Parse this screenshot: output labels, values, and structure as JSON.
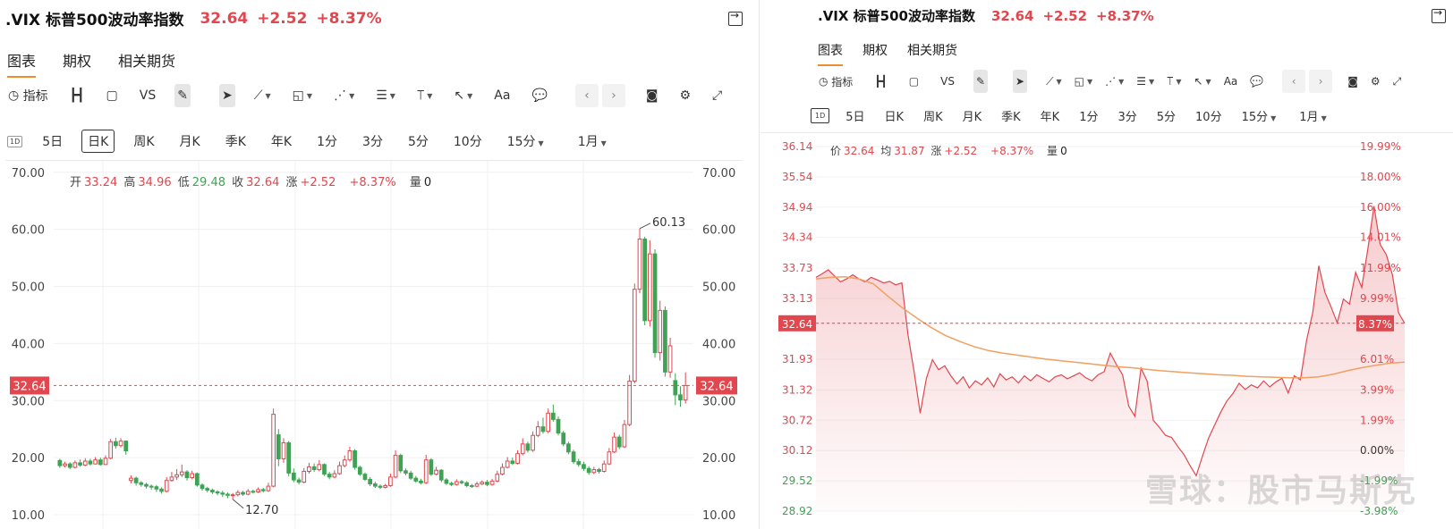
{
  "title": {
    "name": ".VIX 标普500波动率指数",
    "price": "32.64",
    "change": "+2.52",
    "pct": "+8.37%"
  },
  "tabs": [
    "图表",
    "期权",
    "相关期货"
  ],
  "toolbar": {
    "indicators": "指标",
    "vs": "VS",
    "text": "Aa"
  },
  "periods": {
    "chip": "1D",
    "items": [
      "5日",
      "日K",
      "周K",
      "月K",
      "季K",
      "年K",
      "1分",
      "3分",
      "5分",
      "10分",
      "15分"
    ],
    "range": "1月"
  },
  "left_stats": {
    "open_l": "开",
    "open": "33.24",
    "high_l": "高",
    "high": "34.96",
    "low_l": "低",
    "low": "29.48",
    "close_l": "收",
    "close": "32.64",
    "chg_l": "涨",
    "chg": "+2.52",
    "pct": "+8.37%",
    "vol_l": "量",
    "vol": "0"
  },
  "right_stats": {
    "price_l": "价",
    "price": "32.64",
    "avg_l": "均",
    "avg": "31.87",
    "chg_l": "涨",
    "chg": "+2.52",
    "pct": "+8.37%",
    "vol_l": "量",
    "vol": "0"
  },
  "watermark": "雪球：股市马斯克",
  "colors": {
    "up": "#e0474f",
    "down": "#3fa255",
    "avg": "#f0a060",
    "accent": "#f08c2b"
  },
  "chart_data": [
    {
      "type": "candlestick",
      "yticks": [
        "70.00",
        "60.00",
        "50.00",
        "40.00",
        "30.00",
        "20.00",
        "10.00"
      ],
      "ylim": [
        7.5,
        72
      ],
      "current_label": "32.64",
      "annotations": {
        "max": "60.13",
        "min": "12.70"
      },
      "candles": [
        [
          19.5,
          18.6,
          19.8,
          18.2
        ],
        [
          18.6,
          18.9,
          19.3,
          18.3
        ],
        [
          18.9,
          18.3,
          19.2,
          18.0
        ],
        [
          18.3,
          19.1,
          19.5,
          18.1
        ],
        [
          19.1,
          18.7,
          19.7,
          18.4
        ],
        [
          18.7,
          19.4,
          19.9,
          18.5
        ],
        [
          19.4,
          18.9,
          19.8,
          18.6
        ],
        [
          18.9,
          19.6,
          20.1,
          18.8
        ],
        [
          19.6,
          18.8,
          20.0,
          18.6
        ],
        [
          18.8,
          19.9,
          20.4,
          18.7
        ],
        [
          19.9,
          22.8,
          23.3,
          19.7
        ],
        [
          22.8,
          22.1,
          23.5,
          21.6
        ],
        [
          22.1,
          22.9,
          23.4,
          21.8
        ],
        [
          22.9,
          21.2,
          23.0,
          20.5
        ],
        [
          16.0,
          16.4,
          16.9,
          15.5
        ],
        [
          16.4,
          15.6,
          16.7,
          15.1
        ],
        [
          15.6,
          15.3,
          15.9,
          14.9
        ],
        [
          15.3,
          15.0,
          15.6,
          14.6
        ],
        [
          15.0,
          14.9,
          15.3,
          14.4
        ],
        [
          14.9,
          14.5,
          15.2,
          14.0
        ],
        [
          14.5,
          14.1,
          14.8,
          13.7
        ],
        [
          14.1,
          16.0,
          16.6,
          13.9
        ],
        [
          16.0,
          16.6,
          17.5,
          15.8
        ],
        [
          16.6,
          17.0,
          18.0,
          16.1
        ],
        [
          17.0,
          17.5,
          18.8,
          16.6
        ],
        [
          17.5,
          16.5,
          17.8,
          16.0
        ],
        [
          16.5,
          17.2,
          17.7,
          16.2
        ],
        [
          17.2,
          15.2,
          17.4,
          14.9
        ],
        [
          15.2,
          14.6,
          15.5,
          14.2
        ],
        [
          14.6,
          14.3,
          14.9,
          13.9
        ],
        [
          14.3,
          14.0,
          14.6,
          13.6
        ],
        [
          14.0,
          13.8,
          14.3,
          13.4
        ],
        [
          13.8,
          13.6,
          14.2,
          13.1
        ],
        [
          13.6,
          13.4,
          13.9,
          12.9
        ],
        [
          13.4,
          13.5,
          13.8,
          12.7
        ],
        [
          13.5,
          13.9,
          14.3,
          13.2
        ],
        [
          13.9,
          13.6,
          14.2,
          13.3
        ],
        [
          13.6,
          14.1,
          14.5,
          13.4
        ],
        [
          14.1,
          14.0,
          14.4,
          13.7
        ],
        [
          14.0,
          14.4,
          14.8,
          13.8
        ],
        [
          14.4,
          14.2,
          14.7,
          13.9
        ],
        [
          14.2,
          15.0,
          15.6,
          14.0
        ],
        [
          15.0,
          27.6,
          28.6,
          14.8
        ],
        [
          24.0,
          19.8,
          25.0,
          18.5
        ],
        [
          19.8,
          22.6,
          23.4,
          19.1
        ],
        [
          22.6,
          17.3,
          22.9,
          16.7
        ],
        [
          17.3,
          16.1,
          18.1,
          15.7
        ],
        [
          16.1,
          15.7,
          16.5,
          15.3
        ],
        [
          15.7,
          17.6,
          18.2,
          15.5
        ],
        [
          17.6,
          18.4,
          19.1,
          17.2
        ],
        [
          18.4,
          17.9,
          19.0,
          17.5
        ],
        [
          17.9,
          18.8,
          19.6,
          17.6
        ],
        [
          18.8,
          17.1,
          19.0,
          16.8
        ],
        [
          17.1,
          16.6,
          17.5,
          16.2
        ],
        [
          16.6,
          17.2,
          17.8,
          16.4
        ],
        [
          17.2,
          18.6,
          19.3,
          17.0
        ],
        [
          18.6,
          19.6,
          20.4,
          18.3
        ],
        [
          19.6,
          21.2,
          21.9,
          19.3
        ],
        [
          21.2,
          18.3,
          21.5,
          17.9
        ],
        [
          18.3,
          17.1,
          18.6,
          16.8
        ],
        [
          17.1,
          16.2,
          17.4,
          15.9
        ],
        [
          16.2,
          15.4,
          16.6,
          15.0
        ],
        [
          15.4,
          15.0,
          15.8,
          14.7
        ],
        [
          15.0,
          14.8,
          15.3,
          14.5
        ],
        [
          14.8,
          15.1,
          15.4,
          14.6
        ],
        [
          15.1,
          16.6,
          17.2,
          14.9
        ],
        [
          16.6,
          20.4,
          21.3,
          16.4
        ],
        [
          20.4,
          17.7,
          20.7,
          17.3
        ],
        [
          17.7,
          17.3,
          18.1,
          16.9
        ],
        [
          17.3,
          16.4,
          17.7,
          16.1
        ],
        [
          16.4,
          15.9,
          16.8,
          15.6
        ],
        [
          15.9,
          15.6,
          16.3,
          15.3
        ],
        [
          15.6,
          19.6,
          20.5,
          15.4
        ],
        [
          19.6,
          17.1,
          19.9,
          16.8
        ],
        [
          17.1,
          17.8,
          18.4,
          16.9
        ],
        [
          17.8,
          16.1,
          18.0,
          15.7
        ],
        [
          16.1,
          15.5,
          16.4,
          15.2
        ],
        [
          15.5,
          15.3,
          15.8,
          15.0
        ],
        [
          15.3,
          15.8,
          16.2,
          15.1
        ],
        [
          15.8,
          15.6,
          16.1,
          15.3
        ],
        [
          15.6,
          15.1,
          15.9,
          14.8
        ],
        [
          15.1,
          15.0,
          15.4,
          14.7
        ],
        [
          15.0,
          15.4,
          15.8,
          14.8
        ],
        [
          15.4,
          15.7,
          16.0,
          15.2
        ],
        [
          15.7,
          15.3,
          16.1,
          15.0
        ],
        [
          15.3,
          15.9,
          16.3,
          15.1
        ],
        [
          15.9,
          17.1,
          17.7,
          15.7
        ],
        [
          17.1,
          18.3,
          19.0,
          16.9
        ],
        [
          18.3,
          19.4,
          20.1,
          18.1
        ],
        [
          19.4,
          19.0,
          20.0,
          18.7
        ],
        [
          19.0,
          20.7,
          21.3,
          18.8
        ],
        [
          20.7,
          22.4,
          23.4,
          20.4
        ],
        [
          22.4,
          21.3,
          22.8,
          20.9
        ],
        [
          21.3,
          23.9,
          24.6,
          21.0
        ],
        [
          23.9,
          25.4,
          26.4,
          23.6
        ],
        [
          25.4,
          24.6,
          27.0,
          24.2
        ],
        [
          24.6,
          27.8,
          28.6,
          24.3
        ],
        [
          27.8,
          26.7,
          29.3,
          26.3
        ],
        [
          26.7,
          24.3,
          27.2,
          23.9
        ],
        [
          24.3,
          22.4,
          24.7,
          22.0
        ],
        [
          22.4,
          21.0,
          22.8,
          20.6
        ],
        [
          21.0,
          19.3,
          21.4,
          18.9
        ],
        [
          19.3,
          18.8,
          19.8,
          18.4
        ],
        [
          18.8,
          18.1,
          19.3,
          17.7
        ],
        [
          18.1,
          17.4,
          18.5,
          17.0
        ],
        [
          17.4,
          17.9,
          18.4,
          17.1
        ],
        [
          17.9,
          17.6,
          18.2,
          17.2
        ],
        [
          17.6,
          18.9,
          19.5,
          17.4
        ],
        [
          18.9,
          21.0,
          21.7,
          18.7
        ],
        [
          21.0,
          23.6,
          24.4,
          20.8
        ],
        [
          23.6,
          21.9,
          24.0,
          21.5
        ],
        [
          21.9,
          25.8,
          26.6,
          21.7
        ],
        [
          25.8,
          33.4,
          34.5,
          25.5
        ],
        [
          33.4,
          49.5,
          50.5,
          33.0
        ],
        [
          49.5,
          58.3,
          60.13,
          48.8
        ],
        [
          58.3,
          44.0,
          58.7,
          43.2
        ],
        [
          44.0,
          55.7,
          58.1,
          43.0
        ],
        [
          55.7,
          38.4,
          56.5,
          37.5
        ],
        [
          38.4,
          45.8,
          47.5,
          37.0
        ],
        [
          45.8,
          35.0,
          46.5,
          34.2
        ],
        [
          35.0,
          39.6,
          41.0,
          34.0
        ],
        [
          33.5,
          31.0,
          34.8,
          29.2
        ],
        [
          31.0,
          30.1,
          32.5,
          28.9
        ],
        [
          30.1,
          32.64,
          34.96,
          29.48
        ]
      ]
    },
    {
      "type": "line",
      "yticks": [
        "36.14",
        "35.54",
        "34.94",
        "34.34",
        "33.73",
        "33.13",
        "32.64",
        "31.93",
        "31.32",
        "30.72",
        "30.12",
        "29.52",
        "28.92"
      ],
      "pct_ticks": [
        "19.99%",
        "18.00%",
        "16.00%",
        "14.01%",
        "11.99%",
        "9.99%",
        "8.37%",
        "6.01%",
        "3.99%",
        "1.99%",
        "0.00%",
        "-1.99%",
        "-3.98%"
      ],
      "ylim": [
        28.92,
        36.14
      ],
      "base": 30.12,
      "current_label": "32.64",
      "current_pct": "8.37%",
      "series": [
        {
          "values": [
            33.55,
            33.62,
            33.7,
            33.58,
            33.46,
            33.52,
            33.6,
            33.52,
            33.46,
            33.55,
            33.5,
            33.44,
            33.47,
            33.4,
            33.44,
            32.42,
            31.68,
            30.86,
            31.55,
            31.92,
            31.72,
            31.8,
            31.6,
            31.44,
            31.58,
            31.36,
            31.5,
            31.42,
            31.56,
            31.38,
            31.64,
            31.52,
            31.58,
            31.46,
            31.6,
            31.5,
            31.62,
            31.55,
            31.48,
            31.58,
            31.62,
            31.54,
            31.6,
            31.66,
            31.56,
            31.5,
            31.62,
            31.68,
            32.05,
            31.82,
            31.62,
            31.0,
            30.8,
            31.75,
            31.5,
            30.72,
            30.58,
            30.42,
            30.38,
            30.2,
            30.04,
            29.82,
            29.62,
            30.0,
            30.36,
            30.62,
            30.88,
            31.1,
            31.25,
            31.45,
            31.33,
            31.42,
            31.36,
            31.5,
            31.38,
            31.48,
            31.55,
            31.26,
            31.6,
            31.52,
            32.3,
            32.85,
            33.78,
            33.25,
            32.96,
            32.65,
            33.12,
            33.02,
            33.65,
            33.35,
            34.12,
            34.96,
            34.2,
            34.0,
            33.6,
            32.85,
            32.64
          ]
        },
        {
          "values": [
            33.52,
            33.55,
            33.56,
            33.52,
            33.42,
            33.18,
            32.95,
            32.75,
            32.56,
            32.4,
            32.28,
            32.18,
            32.1,
            32.05,
            32.01,
            31.97,
            31.93,
            31.9,
            31.87,
            31.84,
            31.81,
            31.78,
            31.76,
            31.73,
            31.7,
            31.68,
            31.66,
            31.64,
            31.62,
            31.61,
            31.59,
            31.58,
            31.57,
            31.56,
            31.56,
            31.58,
            31.63,
            31.7,
            31.76,
            31.81,
            31.85,
            31.87
          ]
        }
      ]
    }
  ]
}
